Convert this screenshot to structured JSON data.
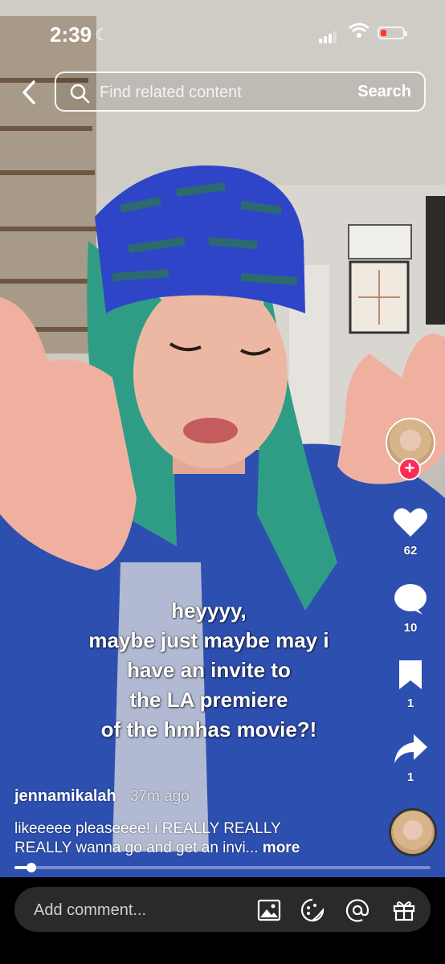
{
  "status": {
    "time": "2:39"
  },
  "search": {
    "placeholder": "Find related content",
    "button": "Search"
  },
  "video": {
    "overlay_lines": [
      "heyyyy,",
      "maybe just maybe may i",
      "have an invite to",
      "the LA premiere",
      "of the hmhas movie?!"
    ],
    "progress_fraction": 0.04
  },
  "actions": {
    "likes": "62",
    "comments": "10",
    "saves": "1",
    "shares": "1"
  },
  "post": {
    "username": "jennamikalah",
    "time_ago": "· 37m ago",
    "caption_line1": "likeeeee pleaseeee! i REALLY REALLY",
    "caption_line2": "REALLY wanna go and get an invi...",
    "more": "more"
  },
  "comment_bar": {
    "placeholder": "Add comment..."
  },
  "colors": {
    "follow": "#fe2c55",
    "comment_bg": "#2a2a2a",
    "battery_low": "#ff3b30"
  }
}
